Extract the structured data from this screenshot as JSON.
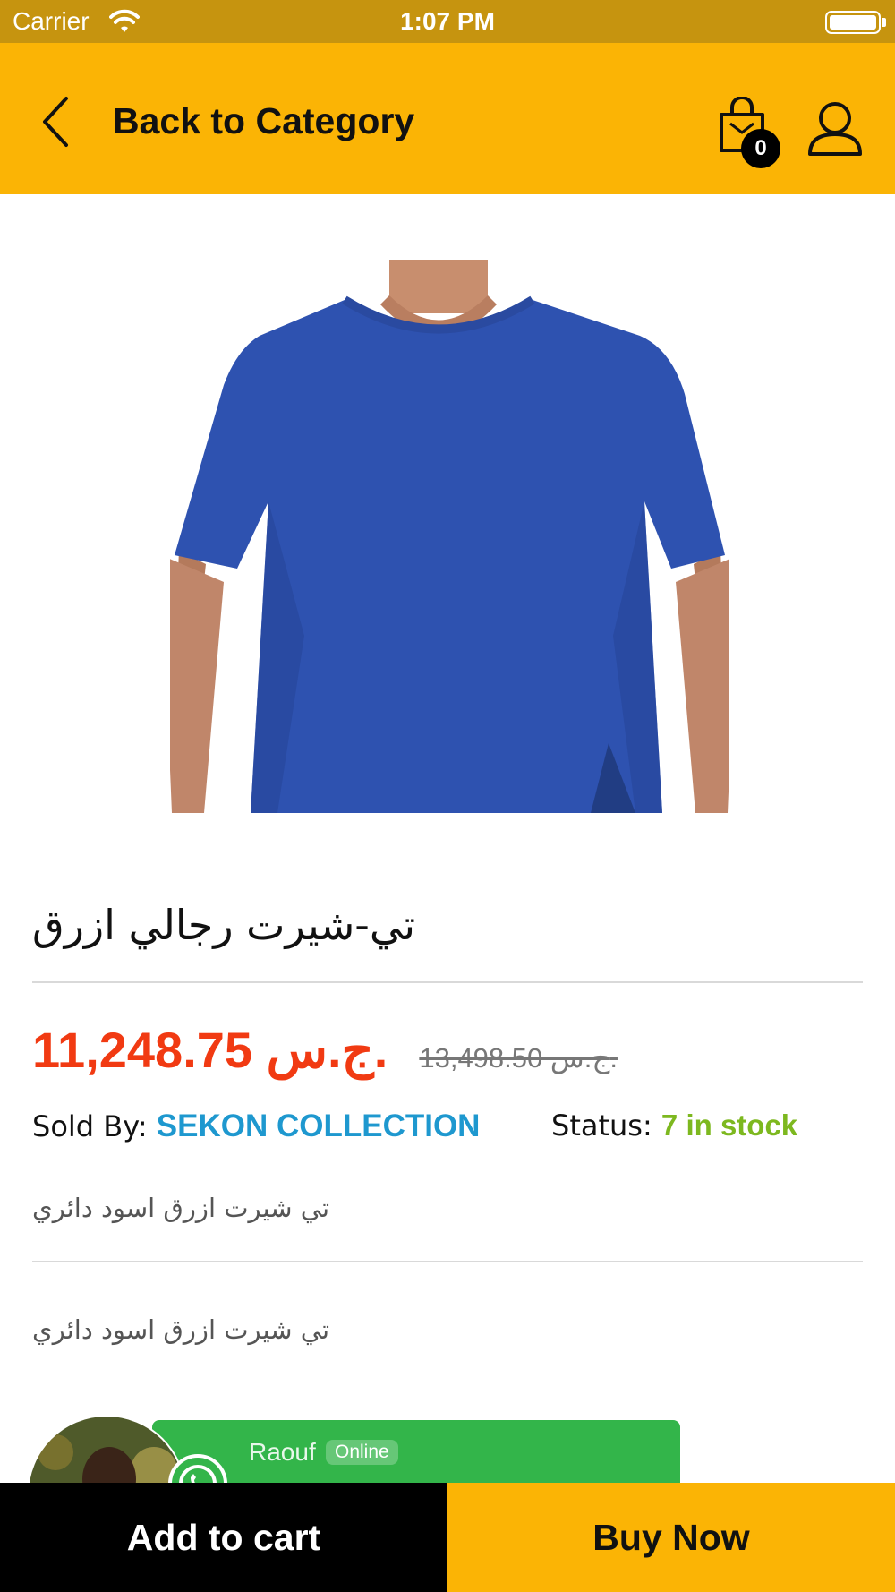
{
  "status_bar": {
    "carrier": "Carrier",
    "time": "1:07 PM",
    "wifi_icon": "wifi-icon",
    "battery_icon": "battery-icon"
  },
  "nav": {
    "back_label": "Back to Category",
    "back_icon": "chevron-left-icon",
    "cart_icon": "shopping-bag-icon",
    "cart_count": "0",
    "user_icon": "user-icon",
    "background": "#FBB405"
  },
  "product": {
    "image": "blue-tshirt-photo",
    "title": "تي-شيرت رجالي ازرق",
    "price_current": "11,248.75 ج.س.",
    "price_old": "13,498.50 ج.س.",
    "sold_by_label": "Sold By:",
    "seller": "SEKON COLLECTION",
    "status_label": "Status:",
    "stock": "7 in stock",
    "short_description": "تي شيرت ازرق اسود دائري",
    "long_description": "تي شيرت ازرق اسود دائري",
    "price_color": "#F13A12",
    "seller_color": "#1E98CF",
    "stock_color": "#7DB81F"
  },
  "chat": {
    "name": "Raouf",
    "status": "Online",
    "icon": "whatsapp-icon",
    "color": "#33B54A"
  },
  "actions": {
    "add_to_cart": "Add to cart",
    "buy_now": "Buy Now"
  }
}
